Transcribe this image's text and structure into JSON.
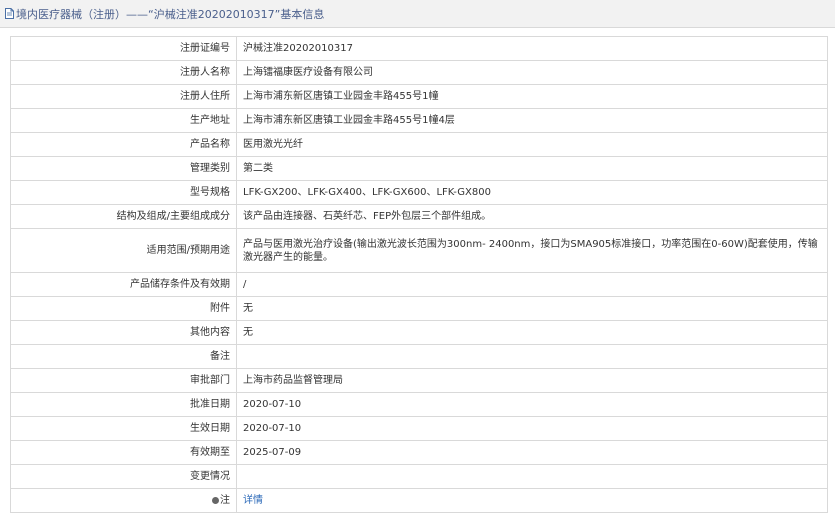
{
  "header": {
    "title": "境内医疗器械（注册）——“沪械注准20202010317”基本信息"
  },
  "rows": [
    {
      "label": "注册证编号",
      "value": "沪械注准20202010317"
    },
    {
      "label": "注册人名称",
      "value": "上海镭福康医疗设备有限公司"
    },
    {
      "label": "注册人住所",
      "value": "上海市浦东新区唐镇工业园金丰路455号1幢"
    },
    {
      "label": "生产地址",
      "value": "上海市浦东新区唐镇工业园金丰路455号1幢4层"
    },
    {
      "label": "产品名称",
      "value": "医用激光光纤"
    },
    {
      "label": "管理类别",
      "value": "第二类"
    },
    {
      "label": "型号规格",
      "value": "LFK-GX200、LFK-GX400、LFK-GX600、LFK-GX800"
    },
    {
      "label": "结构及组成/主要组成成分",
      "value": "该产品由连接器、石英纤芯、FEP外包层三个部件组成。"
    },
    {
      "label": "适用范围/预期用途",
      "value": "产品与医用激光治疗设备(输出激光波长范围为300nm- 2400nm，接口为SMA905标准接口，功率范围在0-60W)配套使用，传输激光器产生的能量。"
    },
    {
      "label": "产品储存条件及有效期",
      "value": "/"
    },
    {
      "label": "附件",
      "value": "无"
    },
    {
      "label": "其他内容",
      "value": "无"
    },
    {
      "label": "备注",
      "value": ""
    },
    {
      "label": "审批部门",
      "value": "上海市药品监督管理局"
    },
    {
      "label": "批准日期",
      "value": "2020-07-10"
    },
    {
      "label": "生效日期",
      "value": "2020-07-10"
    },
    {
      "label": "有效期至",
      "value": "2025-07-09"
    },
    {
      "label": "变更情况",
      "value": ""
    }
  ],
  "note_row": {
    "label": "注",
    "link": "详情"
  }
}
